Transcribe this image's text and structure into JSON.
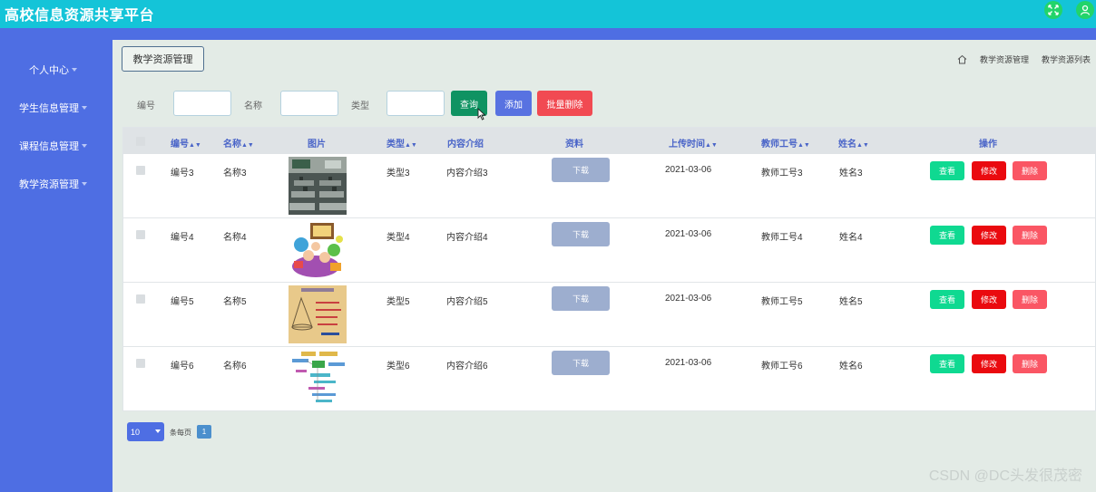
{
  "app": {
    "title": "高校信息资源共享平台"
  },
  "header_icons": [
    "fullscreen-icon",
    "user-icon"
  ],
  "sidebar": {
    "items": [
      {
        "label": "个人中心"
      },
      {
        "label": "学生信息管理"
      },
      {
        "label": "课程信息管理"
      },
      {
        "label": "教学资源管理"
      }
    ]
  },
  "tab": {
    "label": "教学资源管理"
  },
  "breadcrumb": [
    "教学资源管理",
    "教学资源列表"
  ],
  "search": {
    "fields": [
      {
        "label": "编号",
        "value": ""
      },
      {
        "label": "名称",
        "value": ""
      },
      {
        "label": "类型",
        "value": ""
      }
    ],
    "query_label": "查询",
    "add_label": "添加",
    "batch_delete_label": "批量删除"
  },
  "table": {
    "columns": [
      "编号",
      "名称",
      "图片",
      "类型",
      "内容介绍",
      "资料",
      "上传时间",
      "教师工号",
      "姓名",
      "操作"
    ],
    "sortable": [
      "编号",
      "名称",
      "类型",
      "上传时间",
      "教师工号",
      "姓名"
    ],
    "rows": [
      {
        "id": "编号3",
        "name": "名称3",
        "type": "类型3",
        "intro": "内容介绍3",
        "download": "下载",
        "time": "2021-03-06",
        "teacher_no": "教师工号3",
        "teacher_name": "姓名3",
        "image": "classroom"
      },
      {
        "id": "编号4",
        "name": "名称4",
        "type": "类型4",
        "intro": "内容介绍4",
        "download": "下载",
        "time": "2021-03-06",
        "teacher_no": "教师工号4",
        "teacher_name": "姓名4",
        "image": "cartoon"
      },
      {
        "id": "编号5",
        "name": "名称5",
        "type": "类型5",
        "intro": "内容介绍5",
        "download": "下载",
        "time": "2021-03-06",
        "teacher_no": "教师工号5",
        "teacher_name": "姓名5",
        "image": "cone-diagram"
      },
      {
        "id": "编号6",
        "name": "名称6",
        "type": "类型6",
        "intro": "内容介绍6",
        "download": "下载",
        "time": "2021-03-06",
        "teacher_no": "教师工号6",
        "teacher_name": "姓名6",
        "image": "mind-map"
      }
    ],
    "actions": {
      "view": "查看",
      "edit": "修改",
      "delete": "删除"
    }
  },
  "pagination": {
    "page_size": "10",
    "per_page_label": "条每页",
    "current_page": "1"
  },
  "watermark": "CSDN @DC头发很茂密",
  "colors": {
    "topbar": "#14c4d8",
    "sidebar": "#4e6ee3",
    "content_bg": "#e3ebe6",
    "query": "#0f9362",
    "add": "#5872e1",
    "batch_delete": "#f14a52"
  }
}
